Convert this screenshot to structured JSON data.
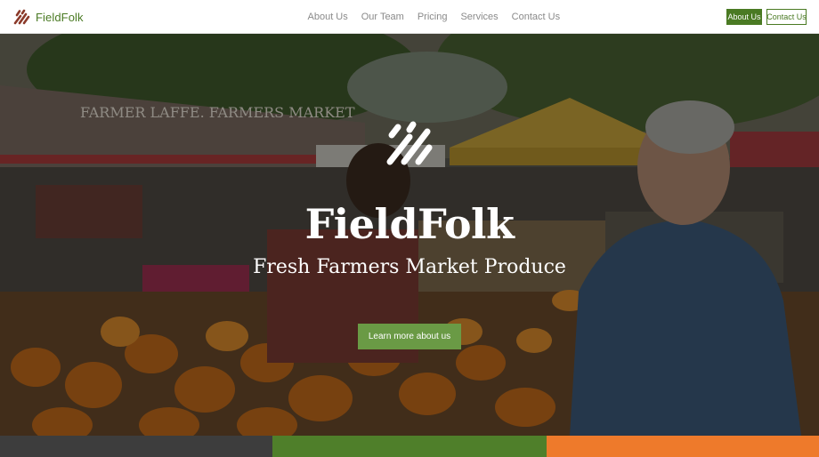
{
  "brand": {
    "name": "FieldFolk",
    "logo_icon": "fieldfolk-slash-mark-icon",
    "color": "#4a7a23",
    "logo_color": "#8b3a2a"
  },
  "nav": {
    "items": [
      {
        "label": "About Us"
      },
      {
        "label": "Our Team"
      },
      {
        "label": "Pricing"
      },
      {
        "label": "Services"
      },
      {
        "label": "Contact Us"
      }
    ]
  },
  "header_buttons": {
    "primary_label": "About Us",
    "secondary_label": "Contact Us"
  },
  "hero": {
    "title": "FieldFolk",
    "subtitle": "Fresh Farmers Market Produce",
    "cta_label": "Learn more about us",
    "background_image": "farmers-market-photo",
    "banner_text": "FARMER LAFFE. FARMERS MARKET"
  },
  "colors": {
    "accent_green": "#4a7a23",
    "cta_green": "#6a9a45",
    "band_gray": "#3d3d3d",
    "band_green": "#4f7f2a",
    "band_orange": "#ee7a2b"
  }
}
